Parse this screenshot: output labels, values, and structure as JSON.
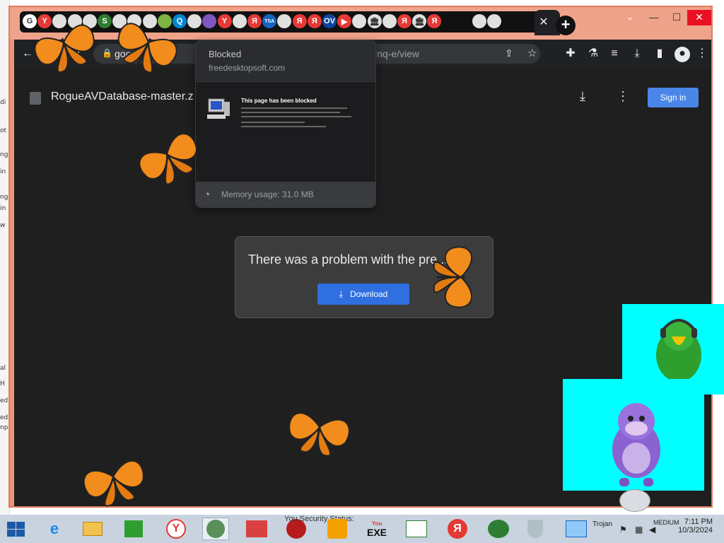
{
  "desktop": {
    "left_chars": [
      "di",
      "ot",
      "ng",
      "in",
      "ng",
      "in",
      "w",
      "al",
      "H",
      "ed",
      "ed",
      "np"
    ]
  },
  "browser": {
    "tab_favicons": [
      {
        "icon": "google-icon",
        "letter": "G",
        "color": "#ffffff"
      },
      {
        "icon": "yandex-icon",
        "letter": "Y",
        "color": "#e53935"
      },
      {
        "icon": "globe-icon",
        "letter": "",
        "color": "#e0e0e0"
      },
      {
        "icon": "news-icon",
        "letter": "",
        "color": "#e0e0e0"
      },
      {
        "icon": "globe-icon",
        "letter": "",
        "color": "#e0e0e0"
      },
      {
        "icon": "s-icon",
        "letter": "S",
        "color": "#2e7d32"
      },
      {
        "icon": "globe-icon",
        "letter": "",
        "color": "#e0e0e0"
      },
      {
        "icon": "globe-icon",
        "letter": "",
        "color": "#e0e0e0"
      },
      {
        "icon": "globe-icon",
        "letter": "",
        "color": "#e0e0e0"
      },
      {
        "icon": "leaf-icon",
        "letter": "",
        "color": "#7cb342"
      },
      {
        "icon": "q-icon",
        "letter": "Q",
        "color": "#0288d1"
      },
      {
        "icon": "globe-icon",
        "letter": "",
        "color": "#e0e0e0"
      },
      {
        "icon": "bonzi-icon",
        "letter": "",
        "color": "#7e57c2"
      },
      {
        "icon": "y-icon",
        "letter": "Y",
        "color": "#e53935"
      },
      {
        "icon": "globe-icon",
        "letter": "",
        "color": "#e0e0e0"
      },
      {
        "icon": "yandex-icon",
        "letter": "Я",
        "color": "#e53935"
      },
      {
        "icon": "tsa-icon",
        "letter": "TSA",
        "color": "#1565c0"
      },
      {
        "icon": "globe-icon",
        "letter": "",
        "color": "#e0e0e0"
      },
      {
        "icon": "yandex-icon",
        "letter": "Я",
        "color": "#e53935"
      },
      {
        "icon": "yandex-icon",
        "letter": "Я",
        "color": "#e53935"
      },
      {
        "icon": "ov-icon",
        "letter": "OV",
        "color": "#0d47a1"
      },
      {
        "icon": "youtube-icon",
        "letter": "▶",
        "color": "#e53935"
      },
      {
        "icon": "globe-icon",
        "letter": "",
        "color": "#e0e0e0"
      },
      {
        "icon": "bank-icon",
        "letter": "🏛",
        "color": "#e0e0e0"
      },
      {
        "icon": "globe-icon",
        "letter": "",
        "color": "#e0e0e0"
      },
      {
        "icon": "yandex-icon",
        "letter": "Я",
        "color": "#e53935"
      },
      {
        "icon": "bank-icon",
        "letter": "🏛",
        "color": "#e0e0e0"
      },
      {
        "icon": "yandex-icon",
        "letter": "Я",
        "color": "#e53935"
      },
      {
        "icon": "blank-icon",
        "letter": "",
        "color": "#111111"
      },
      {
        "icon": "blank-icon",
        "letter": "",
        "color": "#111111"
      },
      {
        "icon": "globe-icon",
        "letter": "",
        "color": "#e0e0e0"
      },
      {
        "icon": "globe-icon",
        "letter": "",
        "color": "#e0e0e0"
      }
    ],
    "address_host": "goo...com/...",
    "address_path": "lnq-e/view",
    "document_title": "RogueAVDatabase-master.z",
    "sign_in_label": "Sign in",
    "error_message": "There was a problem with the pre...",
    "download_label": "Download"
  },
  "hovercard": {
    "title": "Blocked",
    "domain": "freedesktopsoft.com",
    "preview_heading": "This page has been blocked",
    "memory_label": "Memory usage: 31.0 MB"
  },
  "taskbar": {
    "security_label": "You Security Status:",
    "exe_label": "EXE",
    "tray_label": "MEDIUM",
    "time": "7:11 PM",
    "date": "10/3/2024",
    "trojan_label": "Trojan"
  },
  "colors": {
    "accent": "#4a86e8",
    "frame": "#e8957c",
    "page_bg": "#1f1f1f",
    "cyan_panel": "#00ffff"
  }
}
